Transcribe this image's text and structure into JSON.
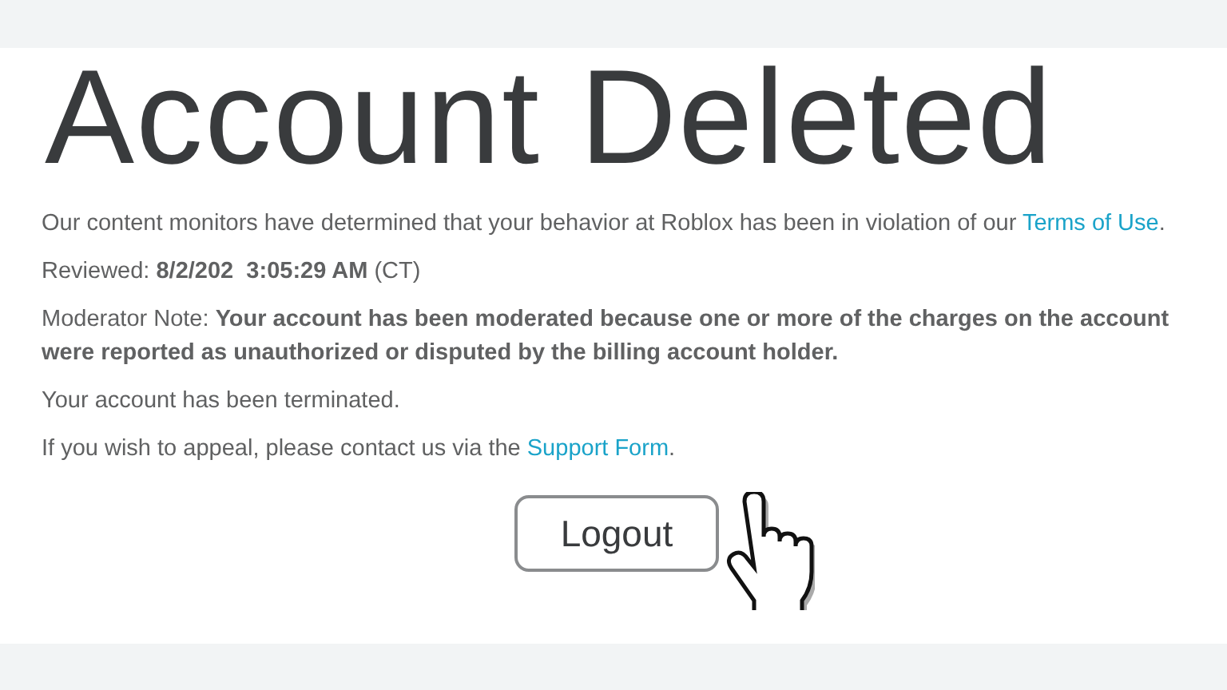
{
  "title": "Account Deleted",
  "paragraphs": [
    {
      "text": "Our content monitors have determined that your behavior at Roblox has been in violation of our ",
      "link": "Terms of Use",
      "after": "."
    },
    {
      "text": "Reviewed: **8/2/202  3:05:29 AM** (CT)"
    },
    {
      "text": "Moderator Note: **Your account has been moderated because one or more of the charges on the account were reported as unauthorized or disputed by the billing account holder.**"
    },
    {
      "text": "Your account has been terminated."
    },
    {
      "text": "If you wish to appeal, please contact us via the ",
      "link": "Support Form",
      "after": "."
    }
  ],
  "button": "Logout"
}
